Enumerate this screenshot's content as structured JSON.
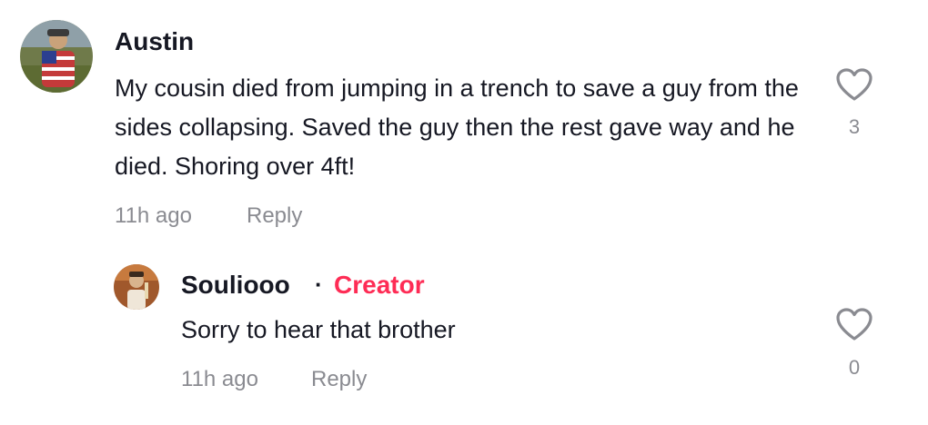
{
  "comments": [
    {
      "username": "Austin",
      "text": "My cousin died from jumping in a trench to save a guy from the sides collapsing. Saved the guy then the rest gave way and he died. Shoring over 4ft!",
      "time": "11h ago",
      "reply_label": "Reply",
      "like_count": "3",
      "avatar_icon": "user-avatar-photo"
    },
    {
      "username": "Souliooo",
      "separator": "·",
      "badge": "Creator",
      "text": "Sorry to hear that brother",
      "time": "11h ago",
      "reply_label": "Reply",
      "like_count": "0",
      "avatar_icon": "user-avatar-photo",
      "is_reply": true
    }
  ],
  "colors": {
    "text_primary": "#161823",
    "text_secondary": "#8a8b91",
    "creator_accent": "#fe2c55",
    "heart_outline": "#8a8b91"
  },
  "icons": {
    "like": "heart-outline-icon"
  }
}
